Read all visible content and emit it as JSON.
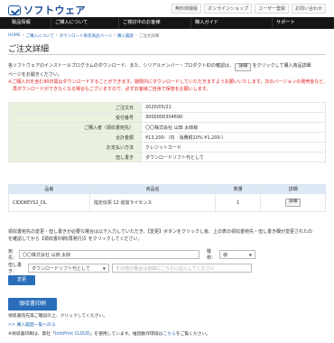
{
  "header": {
    "logo": "ソフトウェア",
    "util_links": [
      "無料体験版",
      "オンラインショップ",
      "ユーザー登録",
      "お問い合わせ"
    ]
  },
  "gnav": [
    "製品情報",
    "ご購入について",
    "ご検討中のお客様",
    "購入ガイド",
    "サポート"
  ],
  "breadcrumb": [
    "HOME",
    "ご購入について",
    "ダウンロード販売商品ページ",
    "購入履歴",
    "ご注文詳細"
  ],
  "page": {
    "title": "ご注文詳細",
    "intro_1a": "各ソフトウェアのインストールプログラムのダウンロード、また、シリアルナンバー・プロダクトIDの確認は、",
    "intro_1b": "をクリックして購入商品詳細",
    "intro_2": "ページをお開きください。",
    "detail_label": "詳細",
    "warning_1": "※ご購入日を含む90日間はダウンロードすることができます。期限内にダウンロードしていただきますようお願いいたします。次のバージョンの発売後など、",
    "warning_2": "　再ダウンロードができなくなる場合もございますので、必ずお客様ご自身で保管をお願いします。"
  },
  "order": [
    {
      "k": "ご注文日",
      "v": "2020/05/21"
    },
    {
      "k": "受付番号",
      "v": "3000000304690"
    },
    {
      "k": "ご購入者（領収書宛先）",
      "v": "〇〇株式会社 山田 太郎様"
    },
    {
      "k": "合計金額",
      "v": "¥13,200-（内　消費税10% ¥1,200-）"
    },
    {
      "k": "お支払い方法",
      "v": "クレジットカード"
    },
    {
      "k": "但し書き",
      "v": "ダウンロードソフト代として"
    }
  ],
  "items": {
    "headers": [
      "品番",
      "商品名",
      "数量",
      "詳細"
    ],
    "rows": [
      {
        "code": "CIDDKEYS2_DL",
        "name": "指定伝票 12 追加ライセンス",
        "qty": "1",
        "detail": "詳細"
      }
    ]
  },
  "receipt": {
    "note_1": "領収書宛先の変更・但し書きが必要な場合は以下入力していただき、【変更】ボタンをクリックし後、上の表の領収書宛先・但し書き欄が変更されたの",
    "note_2": "を確認してから【領収書印刷(再発行)】をクリックしてください。",
    "addressee_label": "宛先：",
    "addressee_value": "〇〇株式会社 山田 太郎",
    "honorific_label": "敬称：",
    "honorific_value": "様",
    "proviso_label": "但し書き：",
    "proviso_value": "ダウンロードソフト代として",
    "proviso_placeholder": "その他の場合は自由にこちらに記入してください",
    "change_button": "変更",
    "print_button": "領収書印刷",
    "print_note": "領収書宛先等ご確認の上、クリックしてください。",
    "back_link": ">> 購入履歴一覧へ戻る",
    "foot_note_a": "※領収書印刷は、弊社「",
    "foot_link": "InfoPrint CLOUD",
    "foot_note_b": "」を使用しています。推奨動作環境は",
    "foot_link2": "こちら",
    "foot_note_c": "をご覧ください。"
  }
}
